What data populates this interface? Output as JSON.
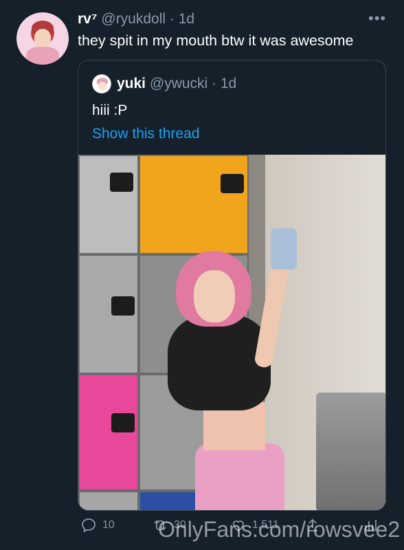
{
  "tweet": {
    "author_name": "rv⁷",
    "handle": "@ryukdoll",
    "time": "· 1d",
    "text": "they spit in my mouth btw it was awesome",
    "more_label": "•••"
  },
  "quote": {
    "author_name": "yuki",
    "handle": "@ywucki",
    "time": "· 1d",
    "text": "hiii :P",
    "show_thread": "Show this thread"
  },
  "actions": {
    "replies": "10",
    "retweets": "30",
    "likes": "1,511"
  },
  "watermark": "OnlyFans.com/rowsvee2",
  "colors": {
    "background": "#15202b",
    "text": "#ffffff",
    "muted": "#8899a6",
    "link": "#1da1f2",
    "border": "#38444d"
  }
}
